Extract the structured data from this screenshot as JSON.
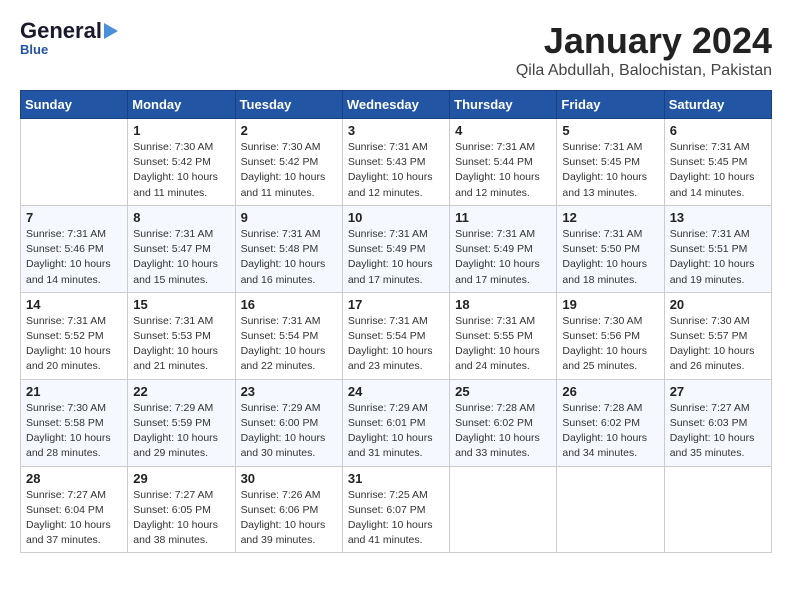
{
  "header": {
    "logo_general": "General",
    "logo_blue": "Blue",
    "title": "January 2024",
    "subtitle": "Qila Abdullah, Balochistan, Pakistan"
  },
  "days_of_week": [
    "Sunday",
    "Monday",
    "Tuesday",
    "Wednesday",
    "Thursday",
    "Friday",
    "Saturday"
  ],
  "weeks": [
    [
      {
        "day": "",
        "info": ""
      },
      {
        "day": "1",
        "info": "Sunrise: 7:30 AM\nSunset: 5:42 PM\nDaylight: 10 hours\nand 11 minutes."
      },
      {
        "day": "2",
        "info": "Sunrise: 7:30 AM\nSunset: 5:42 PM\nDaylight: 10 hours\nand 11 minutes."
      },
      {
        "day": "3",
        "info": "Sunrise: 7:31 AM\nSunset: 5:43 PM\nDaylight: 10 hours\nand 12 minutes."
      },
      {
        "day": "4",
        "info": "Sunrise: 7:31 AM\nSunset: 5:44 PM\nDaylight: 10 hours\nand 12 minutes."
      },
      {
        "day": "5",
        "info": "Sunrise: 7:31 AM\nSunset: 5:45 PM\nDaylight: 10 hours\nand 13 minutes."
      },
      {
        "day": "6",
        "info": "Sunrise: 7:31 AM\nSunset: 5:45 PM\nDaylight: 10 hours\nand 14 minutes."
      }
    ],
    [
      {
        "day": "7",
        "info": "Sunrise: 7:31 AM\nSunset: 5:46 PM\nDaylight: 10 hours\nand 14 minutes."
      },
      {
        "day": "8",
        "info": "Sunrise: 7:31 AM\nSunset: 5:47 PM\nDaylight: 10 hours\nand 15 minutes."
      },
      {
        "day": "9",
        "info": "Sunrise: 7:31 AM\nSunset: 5:48 PM\nDaylight: 10 hours\nand 16 minutes."
      },
      {
        "day": "10",
        "info": "Sunrise: 7:31 AM\nSunset: 5:49 PM\nDaylight: 10 hours\nand 17 minutes."
      },
      {
        "day": "11",
        "info": "Sunrise: 7:31 AM\nSunset: 5:49 PM\nDaylight: 10 hours\nand 17 minutes."
      },
      {
        "day": "12",
        "info": "Sunrise: 7:31 AM\nSunset: 5:50 PM\nDaylight: 10 hours\nand 18 minutes."
      },
      {
        "day": "13",
        "info": "Sunrise: 7:31 AM\nSunset: 5:51 PM\nDaylight: 10 hours\nand 19 minutes."
      }
    ],
    [
      {
        "day": "14",
        "info": "Sunrise: 7:31 AM\nSunset: 5:52 PM\nDaylight: 10 hours\nand 20 minutes."
      },
      {
        "day": "15",
        "info": "Sunrise: 7:31 AM\nSunset: 5:53 PM\nDaylight: 10 hours\nand 21 minutes."
      },
      {
        "day": "16",
        "info": "Sunrise: 7:31 AM\nSunset: 5:54 PM\nDaylight: 10 hours\nand 22 minutes."
      },
      {
        "day": "17",
        "info": "Sunrise: 7:31 AM\nSunset: 5:54 PM\nDaylight: 10 hours\nand 23 minutes."
      },
      {
        "day": "18",
        "info": "Sunrise: 7:31 AM\nSunset: 5:55 PM\nDaylight: 10 hours\nand 24 minutes."
      },
      {
        "day": "19",
        "info": "Sunrise: 7:30 AM\nSunset: 5:56 PM\nDaylight: 10 hours\nand 25 minutes."
      },
      {
        "day": "20",
        "info": "Sunrise: 7:30 AM\nSunset: 5:57 PM\nDaylight: 10 hours\nand 26 minutes."
      }
    ],
    [
      {
        "day": "21",
        "info": "Sunrise: 7:30 AM\nSunset: 5:58 PM\nDaylight: 10 hours\nand 28 minutes."
      },
      {
        "day": "22",
        "info": "Sunrise: 7:29 AM\nSunset: 5:59 PM\nDaylight: 10 hours\nand 29 minutes."
      },
      {
        "day": "23",
        "info": "Sunrise: 7:29 AM\nSunset: 6:00 PM\nDaylight: 10 hours\nand 30 minutes."
      },
      {
        "day": "24",
        "info": "Sunrise: 7:29 AM\nSunset: 6:01 PM\nDaylight: 10 hours\nand 31 minutes."
      },
      {
        "day": "25",
        "info": "Sunrise: 7:28 AM\nSunset: 6:02 PM\nDaylight: 10 hours\nand 33 minutes."
      },
      {
        "day": "26",
        "info": "Sunrise: 7:28 AM\nSunset: 6:02 PM\nDaylight: 10 hours\nand 34 minutes."
      },
      {
        "day": "27",
        "info": "Sunrise: 7:27 AM\nSunset: 6:03 PM\nDaylight: 10 hours\nand 35 minutes."
      }
    ],
    [
      {
        "day": "28",
        "info": "Sunrise: 7:27 AM\nSunset: 6:04 PM\nDaylight: 10 hours\nand 37 minutes."
      },
      {
        "day": "29",
        "info": "Sunrise: 7:27 AM\nSunset: 6:05 PM\nDaylight: 10 hours\nand 38 minutes."
      },
      {
        "day": "30",
        "info": "Sunrise: 7:26 AM\nSunset: 6:06 PM\nDaylight: 10 hours\nand 39 minutes."
      },
      {
        "day": "31",
        "info": "Sunrise: 7:25 AM\nSunset: 6:07 PM\nDaylight: 10 hours\nand 41 minutes."
      },
      {
        "day": "",
        "info": ""
      },
      {
        "day": "",
        "info": ""
      },
      {
        "day": "",
        "info": ""
      }
    ]
  ]
}
